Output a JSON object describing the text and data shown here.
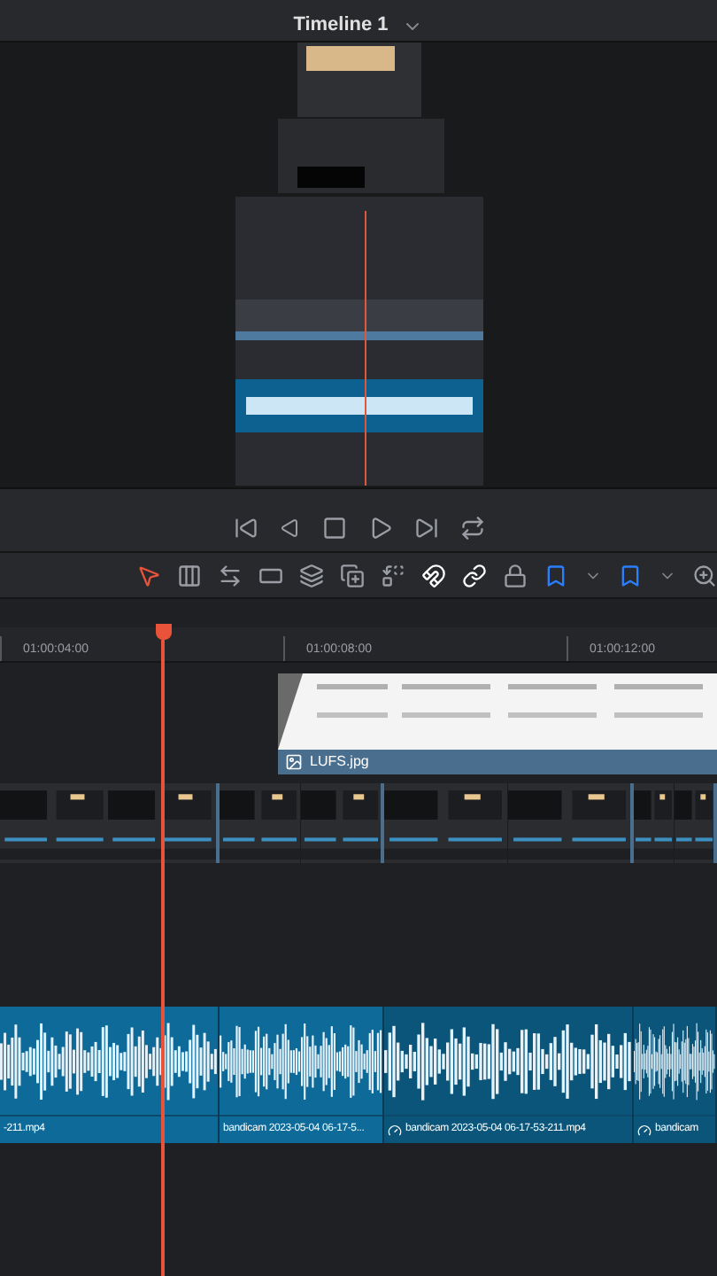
{
  "header": {
    "title": "Timeline 1"
  },
  "ruler": {
    "timecodes": [
      "01:00:04:00",
      "01:00:08:00",
      "01:00:12:00"
    ]
  },
  "video_track_2": {
    "clips": [
      {
        "label": "LUFS.jpg"
      }
    ]
  },
  "audio_track": {
    "clips": [
      {
        "label": "-211.mp4",
        "selected": true,
        "retimed": false
      },
      {
        "label": "bandicam 2023-05-04 06-17-5...",
        "selected": true,
        "retimed": false
      },
      {
        "label": "bandicam 2023-05-04 06-17-53-211.mp4",
        "selected": false,
        "retimed": true
      },
      {
        "label": "bandicam",
        "selected": false,
        "retimed": true
      }
    ]
  }
}
